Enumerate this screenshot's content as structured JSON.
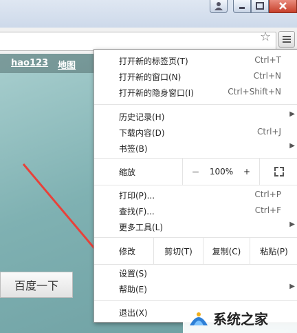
{
  "toolbar": {
    "star_icon": "star-icon",
    "menu_icon": "hamburger-icon"
  },
  "page": {
    "nav_links": [
      "hao123",
      "地图"
    ],
    "search_button": "百度一下"
  },
  "menu": {
    "group1": [
      {
        "label": "打开新的标签页(T)",
        "shortcut": "Ctrl+T"
      },
      {
        "label": "打开新的窗口(N)",
        "shortcut": "Ctrl+N"
      },
      {
        "label": "打开新的隐身窗口(I)",
        "shortcut": "Ctrl+Shift+N"
      }
    ],
    "group2": [
      {
        "label": "历史记录(H)"
      },
      {
        "label": "下载内容(D)",
        "shortcut": "Ctrl+J"
      },
      {
        "label": "书签(B)"
      }
    ],
    "zoom": {
      "label": "缩放",
      "minus": "－",
      "value": "100%",
      "plus": "+"
    },
    "group3": [
      {
        "label": "打印(P)...",
        "shortcut": "Ctrl+P"
      },
      {
        "label": "查找(F)...",
        "shortcut": "Ctrl+F"
      },
      {
        "label": "更多工具(L)"
      }
    ],
    "edit": {
      "label": "修改",
      "cut": "剪切(T)",
      "copy": "复制(C)",
      "paste": "粘贴(P)"
    },
    "group4": [
      {
        "label": "设置(S)"
      },
      {
        "label": "帮助(E)"
      }
    ],
    "exit": {
      "label": "退出(X)"
    }
  },
  "watermark": {
    "text": "系统之家"
  },
  "colors": {
    "arrow": "#e8413a",
    "page_bg": "#7fb1b2"
  }
}
